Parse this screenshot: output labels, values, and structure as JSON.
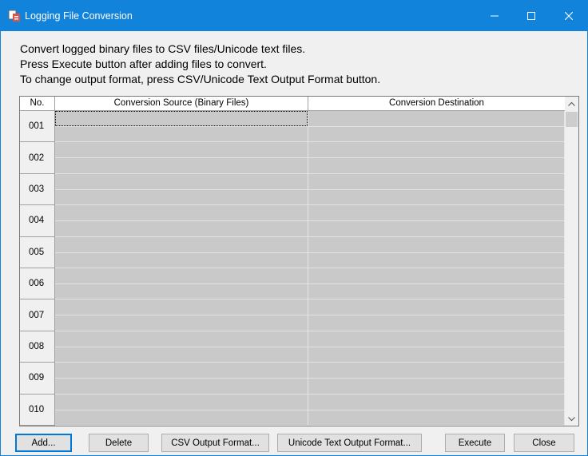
{
  "window": {
    "title": "Logging File Conversion"
  },
  "instructions": [
    "Convert logged binary files to CSV files/Unicode text files.",
    "Press Execute button after adding files to convert.",
    "To change output format, press CSV/Unicode Text Output Format button."
  ],
  "table": {
    "headers": {
      "no": "No.",
      "source": "Conversion Source (Binary Files)",
      "destination": "Conversion Destination"
    },
    "rows": [
      "001",
      "002",
      "003",
      "004",
      "005",
      "006",
      "007",
      "008",
      "009",
      "010"
    ]
  },
  "buttons": {
    "add": "Add...",
    "delete": "Delete",
    "csv_format": "CSV Output Format...",
    "unicode_format": "Unicode Text Output Format...",
    "execute": "Execute",
    "close": "Close"
  },
  "colors": {
    "titlebar": "#1283db",
    "cell": "#c9c9c9",
    "grid_bg": "#ababab"
  }
}
